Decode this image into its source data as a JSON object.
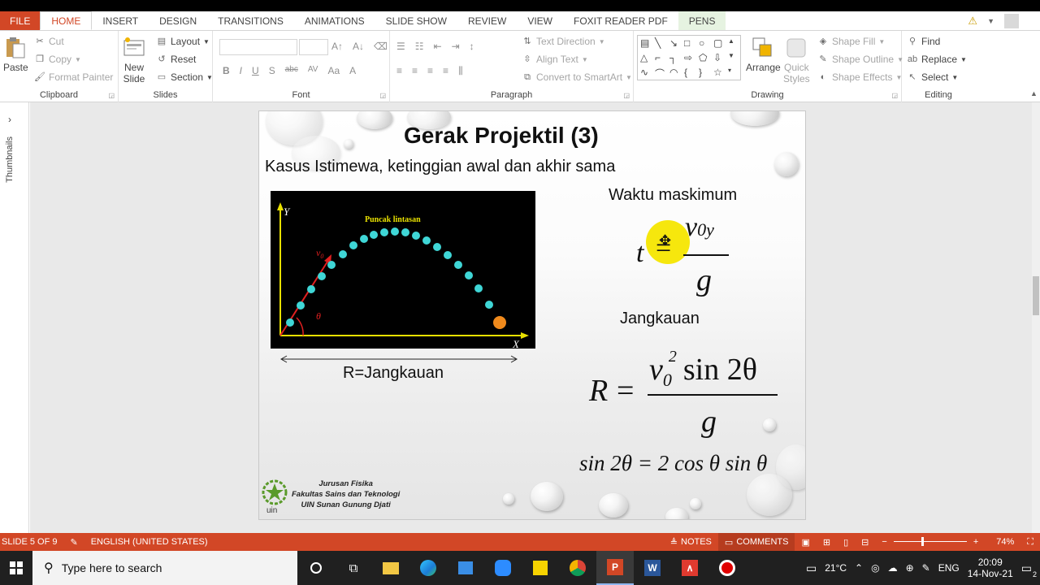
{
  "ribbon_tabs": [
    {
      "label": "FILE"
    },
    {
      "label": "HOME"
    },
    {
      "label": "INSERT"
    },
    {
      "label": "DESIGN"
    },
    {
      "label": "TRANSITIONS"
    },
    {
      "label": "ANIMATIONS"
    },
    {
      "label": "SLIDE SHOW"
    },
    {
      "label": "REVIEW"
    },
    {
      "label": "VIEW"
    },
    {
      "label": "FOXIT READER PDF"
    },
    {
      "label": "PENS"
    }
  ],
  "ribbon": {
    "clipboard": {
      "label": "Clipboard",
      "paste": "Paste",
      "cut": "Cut",
      "copy": "Copy",
      "format_painter": "Format Painter"
    },
    "slides": {
      "label": "Slides",
      "new_slide": "New\nSlide",
      "layout": "Layout",
      "reset": "Reset",
      "section": "Section"
    },
    "font": {
      "label": "Font",
      "bold": "B",
      "italic": "I",
      "underline": "U",
      "shadow": "S",
      "strike": "abc",
      "spacing": "AV",
      "case": "Aa",
      "color": "A"
    },
    "paragraph": {
      "label": "Paragraph",
      "text_direction": "Text Direction",
      "align_text": "Align Text",
      "convert_smartart": "Convert to SmartArt"
    },
    "drawing": {
      "label": "Drawing",
      "arrange": "Arrange",
      "quick_styles": "Quick\nStyles",
      "shape_fill": "Shape Fill",
      "shape_outline": "Shape Outline",
      "shape_effects": "Shape Effects"
    },
    "editing": {
      "label": "Editing",
      "find": "Find",
      "replace": "Replace",
      "select": "Select"
    }
  },
  "thumbnails_label": "Thumbnails",
  "slide": {
    "title": "Gerak Projektil (3)",
    "subtitle": "Kasus Istimewa, ketinggian awal dan akhir sama",
    "figure": {
      "y_axis": "Y",
      "x_axis": "X",
      "peak_label": "Puncak lintasan",
      "v0_label": "v",
      "v0_sub": "0",
      "theta_label": "θ"
    },
    "range_caption": "R=Jangkauan",
    "max_time_label": "Waktu maskimum",
    "range_label": "Jangkauan",
    "eq_t": {
      "lhs": "t",
      "eq": "=",
      "num": "v",
      "num_sub": "0y",
      "den": "g"
    },
    "eq_r": {
      "lhs": "R",
      "eq": "=",
      "num_v": "v",
      "num_sub": "0",
      "num_sup": "2",
      "num_rest": "sin 2θ",
      "den": "g"
    },
    "identity": "sin 2θ = 2 cos θ sin θ",
    "org_lines": [
      "Jurusan Fisika",
      "Fakultas Sains dan Teknologi",
      "UIN Sunan Gunung Djati"
    ],
    "logo_text": "uin"
  },
  "status_bar": {
    "slide_count": "SLIDE 5 OF 9",
    "language": "ENGLISH (UNITED STATES)",
    "notes": "NOTES",
    "comments": "COMMENTS",
    "zoom": "74%"
  },
  "taskbar": {
    "search_placeholder": "Type here to search",
    "weather": "21°C",
    "lang": "ENG",
    "time": "20:09",
    "date": "14-Nov-21",
    "notif_count": "2"
  },
  "colors": {
    "accent": "#d24726",
    "figure_bg": "#000000",
    "dot": "#3fd6d6",
    "ball": "#f08a1c",
    "highlight": "#f5e600"
  }
}
